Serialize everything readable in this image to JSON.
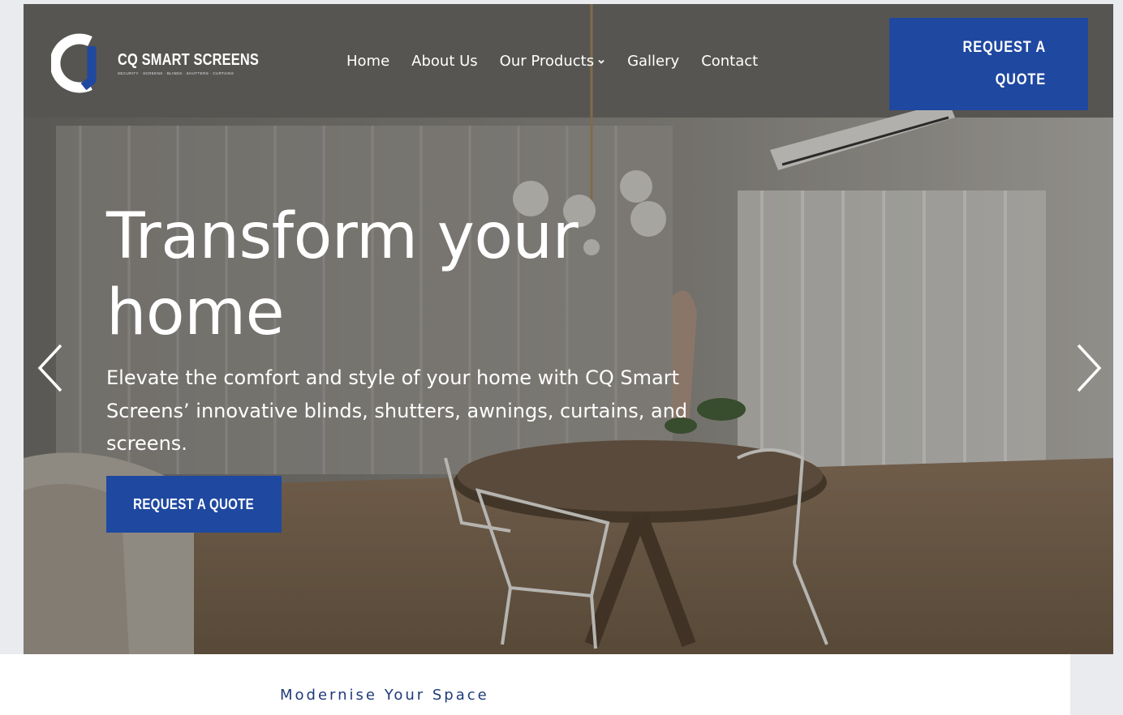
{
  "brand": {
    "name": "CQ SMART SCREENS",
    "tagline": "SECURITY · SCREENS · BLINDS · SHUTTERS · CURTAINS",
    "accent": "#1f48a0"
  },
  "nav": {
    "items": [
      {
        "label": "Home"
      },
      {
        "label": "About Us"
      },
      {
        "label": "Our Products",
        "has_dropdown": true
      },
      {
        "label": "Gallery"
      },
      {
        "label": "Contact"
      }
    ]
  },
  "header_cta": {
    "label": "REQUEST A QUOTE"
  },
  "hero": {
    "headline": "Transform your home",
    "subtext": "Elevate the comfort and style of your home with CQ Smart Screens’ innovative blinds, shutters, awnings, curtains, and screens.",
    "cta_label": "REQUEST A QUOTE",
    "prev_icon": "chevron-left-icon",
    "next_icon": "chevron-right-icon"
  },
  "section": {
    "kicker": "Modernise Your Space"
  }
}
